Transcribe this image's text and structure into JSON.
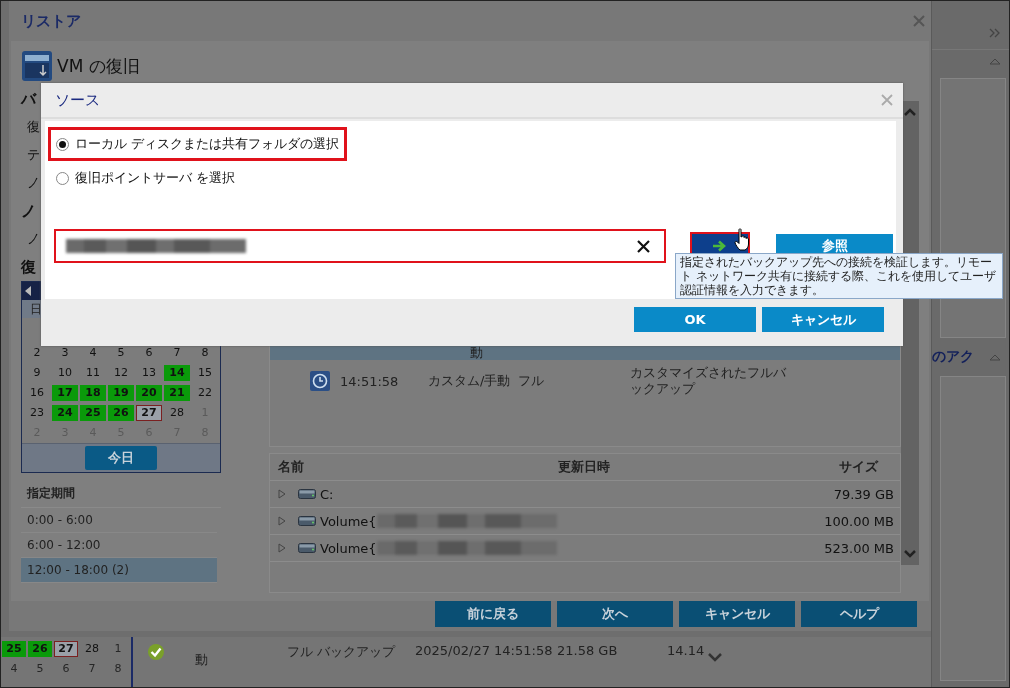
{
  "background_app": {
    "calendar_weeks": [
      [
        {
          "day": "25",
          "kind": "backup"
        },
        {
          "day": "26",
          "kind": "backup"
        },
        {
          "day": "27",
          "kind": "today"
        },
        {
          "day": "28",
          "kind": "normal"
        },
        {
          "day": "1",
          "kind": "other"
        }
      ],
      [
        {
          "day": "4",
          "kind": "other"
        },
        {
          "day": "5",
          "kind": "other"
        },
        {
          "day": "6",
          "kind": "other"
        },
        {
          "day": "7",
          "kind": "other"
        },
        {
          "day": "8",
          "kind": "other"
        }
      ]
    ],
    "job_row": {
      "method": "動",
      "type": "フル バックアップ",
      "time": "2025/02/27 14:51:58",
      "size": "21.58 GB",
      "column_5": "14.14"
    },
    "side_panel": {
      "section_title": "のアク"
    }
  },
  "restore_dialog": {
    "title": "リストア",
    "heading": "VM の復旧",
    "left_labels": [
      {
        "text": "バ",
        "kind": "heading"
      },
      {
        "text": "復",
        "kind": "item"
      },
      {
        "text": "テ",
        "kind": "item"
      },
      {
        "text": "ノ",
        "kind": "item"
      },
      {
        "text": "ノ",
        "kind": "heading"
      },
      {
        "text": "ノ",
        "kind": "item"
      },
      {
        "text": "復",
        "kind": "heading"
      }
    ],
    "calendar": {
      "weekday": "日",
      "weeks": [
        [
          {
            "day": "2",
            "kind": "normal"
          },
          {
            "day": "3",
            "kind": "normal"
          },
          {
            "day": "4",
            "kind": "normal"
          },
          {
            "day": "5",
            "kind": "normal"
          },
          {
            "day": "6",
            "kind": "normal"
          },
          {
            "day": "7",
            "kind": "normal"
          },
          {
            "day": "8",
            "kind": "normal"
          }
        ],
        [
          {
            "day": "9",
            "kind": "normal"
          },
          {
            "day": "10",
            "kind": "normal"
          },
          {
            "day": "11",
            "kind": "normal"
          },
          {
            "day": "12",
            "kind": "normal"
          },
          {
            "day": "13",
            "kind": "normal"
          },
          {
            "day": "14",
            "kind": "backup"
          },
          {
            "day": "15",
            "kind": "normal"
          }
        ],
        [
          {
            "day": "16",
            "kind": "normal"
          },
          {
            "day": "17",
            "kind": "backup"
          },
          {
            "day": "18",
            "kind": "backup"
          },
          {
            "day": "19",
            "kind": "backup"
          },
          {
            "day": "20",
            "kind": "backup"
          },
          {
            "day": "21",
            "kind": "backup"
          },
          {
            "day": "22",
            "kind": "normal"
          }
        ],
        [
          {
            "day": "23",
            "kind": "normal"
          },
          {
            "day": "24",
            "kind": "backup"
          },
          {
            "day": "25",
            "kind": "backup"
          },
          {
            "day": "26",
            "kind": "backup"
          },
          {
            "day": "27",
            "kind": "today"
          },
          {
            "day": "28",
            "kind": "normal"
          },
          {
            "day": "1",
            "kind": "other"
          }
        ],
        [
          {
            "day": "2",
            "kind": "other"
          },
          {
            "day": "3",
            "kind": "other"
          },
          {
            "day": "4",
            "kind": "other"
          },
          {
            "day": "5",
            "kind": "other"
          },
          {
            "day": "6",
            "kind": "other"
          },
          {
            "day": "7",
            "kind": "other"
          },
          {
            "day": "8",
            "kind": "other"
          }
        ]
      ],
      "today_button": "今日"
    },
    "period_title": "指定期間",
    "periods": [
      {
        "label": "0:00 - 6:00",
        "selected": false
      },
      {
        "label": "6:00 - 12:00",
        "selected": false
      },
      {
        "label": "12:00 - 18:00   (2)",
        "selected": true
      }
    ],
    "recovery_points": [
      {
        "method": "動",
        "selected": true
      },
      {
        "time": "14:51:58",
        "method": "カスタム/手動",
        "type": "フル",
        "description": "カスタマイズされたフルバックアップ",
        "selected": false
      }
    ],
    "files": {
      "columns": [
        "名前",
        "更新日時",
        "サイズ"
      ],
      "rows": [
        {
          "name": "C:",
          "blurred": false,
          "size": "79.39 GB"
        },
        {
          "name": "Volume{",
          "blurred": true,
          "size": "100.00 MB"
        },
        {
          "name": "Volume{",
          "blurred": true,
          "size": "523.00 MB"
        }
      ]
    },
    "buttons": [
      "前に戻る",
      "次へ",
      "キャンセル",
      "ヘルプ"
    ]
  },
  "source_dialog": {
    "title": "ソース",
    "options": [
      {
        "label": "ローカル ディスクまたは共有フォルダの選択",
        "selected": true,
        "highlighted": true
      },
      {
        "label": "復旧ポイントサーバ を選択",
        "selected": false,
        "highlighted": false
      }
    ],
    "path_field": {
      "blurred": true,
      "highlighted": true
    },
    "verify_button": {
      "highlighted": true
    },
    "browse_button": "参照",
    "buttons": [
      "OK",
      "キャンセル"
    ],
    "tooltip": "指定されたバックアップ先への接続を検証します。リモート ネットワーク共有に接続する際、これを使用してユーザ認証情報を入力できます。"
  }
}
